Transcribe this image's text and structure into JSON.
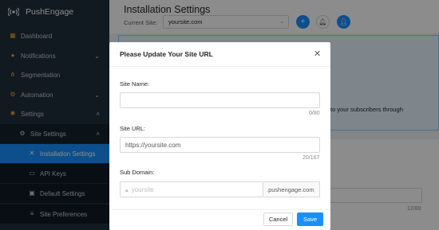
{
  "sidebar": {
    "brand": "PushEngage",
    "items": [
      {
        "label": "Dashboard",
        "icon": "dashboard-icon"
      },
      {
        "label": "Notifications",
        "icon": "bell-icon"
      },
      {
        "label": "Segmentation",
        "icon": "segmentation-icon"
      },
      {
        "label": "Automation",
        "icon": "automation-icon"
      },
      {
        "label": "Settings",
        "icon": "gear-icon"
      },
      {
        "label": "Site Settings",
        "icon": "gear-icon"
      },
      {
        "label": "Installation Settings",
        "icon": "tools-icon"
      },
      {
        "label": "API Keys",
        "icon": "key-icon"
      },
      {
        "label": "Default Settings",
        "icon": "settings-icon"
      },
      {
        "label": "Site Preferences",
        "icon": "preferences-icon"
      }
    ]
  },
  "header": {
    "title": "Installation Settings",
    "current_site_label": "Current Site:",
    "current_site_value": "yoursite.com"
  },
  "background": {
    "card_text": "to your subscribers through",
    "counter": "12/80"
  },
  "modal": {
    "title": "Please Update Your Site URL",
    "site_name_label": "Site Name:",
    "site_name_value": "",
    "site_name_counter": "0/80",
    "site_url_label": "Site URL:",
    "site_url_value": "https://yoursite.com",
    "site_url_counter": "20/167",
    "sub_domain_label": "Sub Domain:",
    "sub_domain_placeholder": "yoursite",
    "sub_domain_suffix": ".pushengage.com",
    "cancel_label": "Cancel",
    "save_label": "Save"
  },
  "colors": {
    "accent": "#1890ff",
    "sidebar": "#1f2f3d",
    "icon_accent": "#f0a030"
  }
}
